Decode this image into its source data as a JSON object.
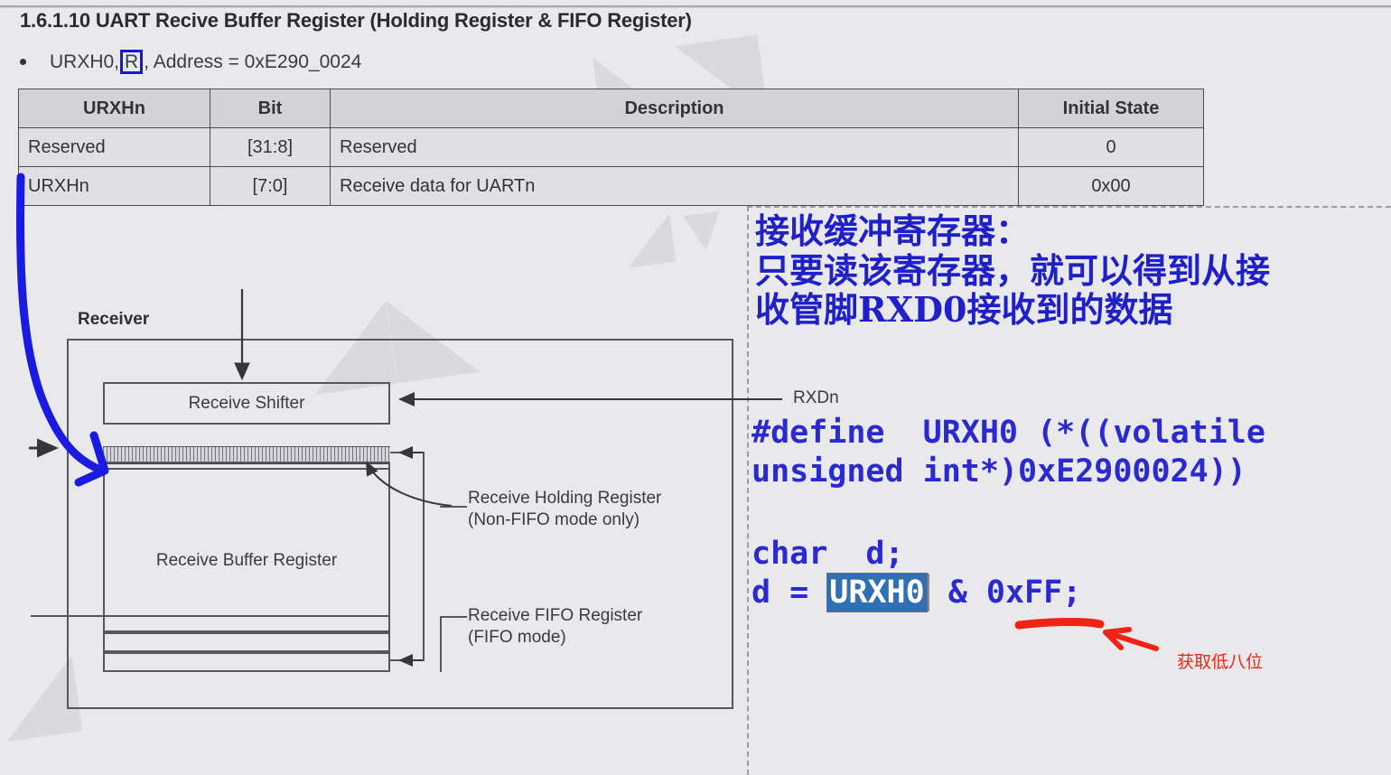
{
  "document": {
    "heading": "1.6.1.10  UART Recive Buffer Register (Holding Register & FIFO Register)",
    "bullet": {
      "prefix": "URXH0,",
      "access": "R",
      "suffix": ", Address = 0xE290_0024"
    }
  },
  "register_table": {
    "headers": [
      "URXHn",
      "Bit",
      "Description",
      "Initial State"
    ],
    "rows": [
      {
        "name": "Reserved",
        "bit": "[31:8]",
        "description": "Reserved",
        "initial": "0"
      },
      {
        "name": "URXHn",
        "bit": "[7:0]",
        "description": "Receive data for UARTn",
        "initial": "0x00"
      }
    ]
  },
  "diagram": {
    "title": "Receiver",
    "shifter_label": "Receive Shifter",
    "buffer_label": "Receive Buffer Register",
    "holding_label": "Receive Holding Register\n(Non-FIFO mode only)",
    "fifo_label": "Receive FIFO Register\n(FIFO mode)",
    "rxdn_label": "RXDn"
  },
  "annotation": {
    "chinese_note": "接收缓冲寄存器：\n只要读该寄存器，就可以得到从接\n收管脚RXD0接收到的数据",
    "code_define": "#define  URXH0 (*((volatile\nunsigned int*)0xE2900024))",
    "code_decl": "char  d;",
    "code_assign_prefix": "d = ",
    "code_selected": "URXH0",
    "code_assign_suffix": " & 0xFF;",
    "red_note": "获取低八位"
  },
  "colors": {
    "page_background": "#e9e9eb",
    "table_header": "#d3d3d5",
    "blue_ink": "#1414e6",
    "code_blue": "#2a2ad0",
    "selection_blue": "#2f6fb5",
    "red_ink": "#f02414",
    "line_gray": "#56565e"
  },
  "watermarks": [
    "◣◤",
    "◢◣",
    "◥◤",
    "◤"
  ]
}
